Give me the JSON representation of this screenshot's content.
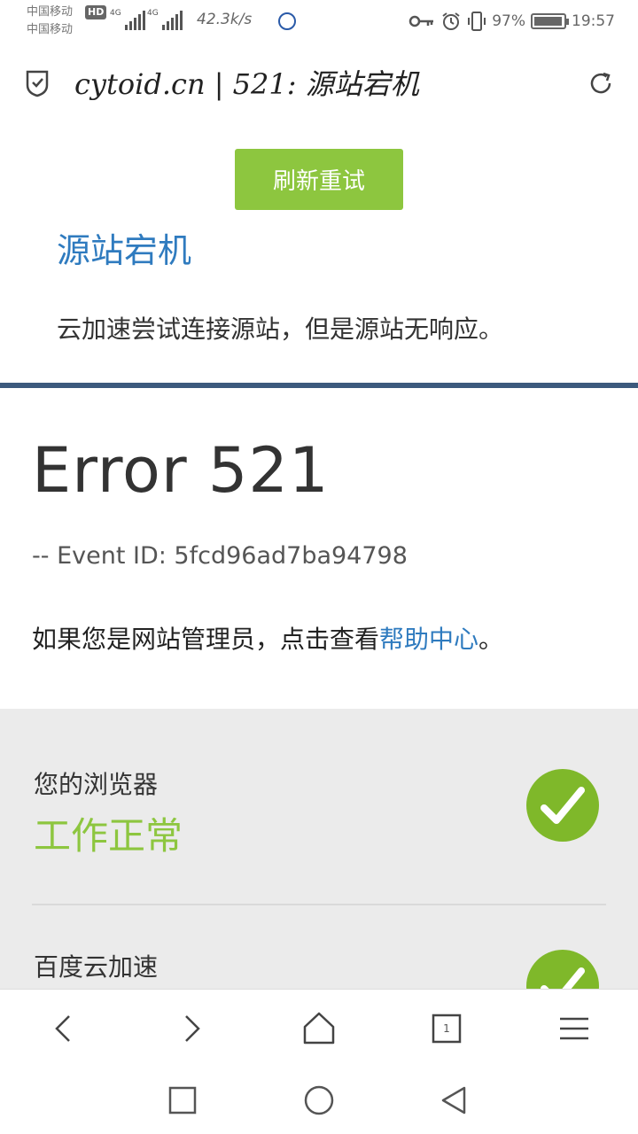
{
  "status_bar": {
    "carrier1": "中国移动",
    "carrier2": "中国移动",
    "hd_badge": "HD",
    "network1": "4G",
    "network2": "4G",
    "net_speed": "42.3k/s",
    "battery_percent": "97%",
    "battery_level": 0.97,
    "time": "19:57",
    "icons": [
      "key-icon",
      "alarm-icon",
      "vibrate-icon",
      "battery-icon"
    ]
  },
  "address_bar": {
    "title": "cytoid.cn | 521: 源站宕机",
    "icons": [
      "shield-icon",
      "reload-icon"
    ]
  },
  "error_card": {
    "retry_button": "刷新重试",
    "title": "源站宕机",
    "description": "云加速尝试连接源站，但是源站无响应。"
  },
  "error_info": {
    "code": "Error 521",
    "event_id": "-- Event ID: 5fcd96ad7ba94798",
    "admin_prefix": "如果您是网站管理员，点击查看",
    "help_link": "帮助中心",
    "admin_suffix": "。"
  },
  "status_items": [
    {
      "label": "您的浏览器",
      "value": "工作正常",
      "ok": true
    },
    {
      "label": "百度云加速",
      "value": "",
      "ok": true
    }
  ],
  "colors": {
    "accent_green": "#8dc63f",
    "link_blue": "#2f7bbf",
    "divider_blue": "#3c5a7d",
    "panel_gray": "#ebebeb"
  },
  "toolbar": {
    "icons": [
      "back-icon",
      "forward-icon",
      "home-icon",
      "tabs-icon",
      "menu-icon"
    ],
    "tab_count": "1"
  },
  "nav_bar": {
    "icons": [
      "recents-icon",
      "home-circle-icon",
      "back-triangle-icon"
    ]
  }
}
